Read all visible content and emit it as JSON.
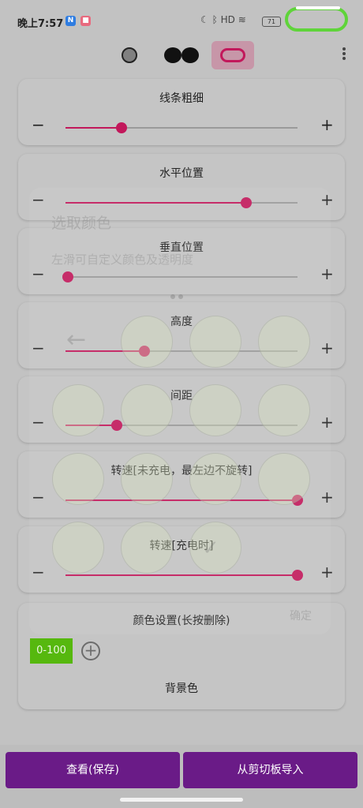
{
  "status_bar": {
    "time": "晚上7:57",
    "signal": "HD",
    "battery": "71"
  },
  "sliders": [
    {
      "label": "线条粗细",
      "value": 0.24
    },
    {
      "label": "水平位置",
      "value": 0.78
    },
    {
      "label": "垂直位置",
      "value": 0.01
    },
    {
      "label": "高度",
      "value": 0.34
    },
    {
      "label": "间距",
      "value": 0.22
    },
    {
      "label": "转速[未充电，最左边不旋转]",
      "value": 1.0
    },
    {
      "label": "转速[充电时]",
      "value": 1.0
    }
  ],
  "controls": {
    "minus": "−",
    "plus": "+"
  },
  "color_settings": {
    "title": "颜色设置(长按删除)",
    "range_chip": "0-100",
    "add_symbol": "+",
    "background_label": "背景色"
  },
  "overlay": {
    "title": "选取颜色",
    "subtitle": "左滑可自定义颜色及透明度",
    "back": "←",
    "check": "✓",
    "confirm": "确定"
  },
  "buttons": {
    "view_save": "查看(保存)",
    "import_clipboard": "从剪切板导入"
  },
  "colors": {
    "accent": "#c2185b",
    "button": "#6a1b87",
    "chip": "#56b80e",
    "highlight": "#5fd43a"
  }
}
